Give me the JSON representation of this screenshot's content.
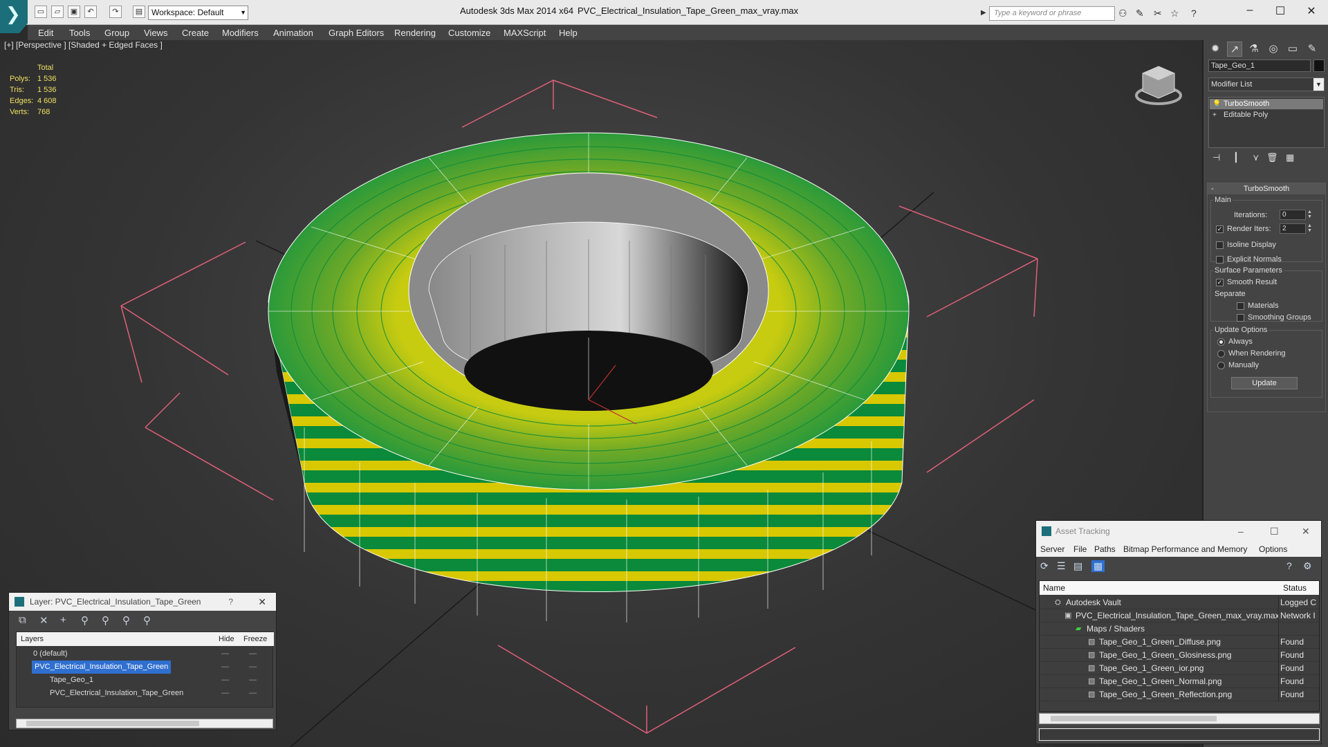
{
  "titlebar": {
    "workspace": "Workspace: Default",
    "app_title": "Autodesk 3ds Max  2014 x64",
    "file_title": "PVC_Electrical_Insulation_Tape_Green_max_vray.max",
    "search_placeholder": "Type a keyword or phrase"
  },
  "menu": [
    "Edit",
    "Tools",
    "Group",
    "Views",
    "Create",
    "Modifiers",
    "Animation",
    "Graph Editors",
    "Rendering",
    "Customize",
    "MAXScript",
    "Help"
  ],
  "viewport": {
    "label": "[+] [Perspective ] [Shaded + Edged Faces ]",
    "stats_header": "Total",
    "stats": [
      {
        "label": "Polys:",
        "value": "1 536"
      },
      {
        "label": "Tris:",
        "value": "1 536"
      },
      {
        "label": "Edges:",
        "value": "4 608"
      },
      {
        "label": "Verts:",
        "value": "768"
      }
    ]
  },
  "command_panel": {
    "object_name": "Tape_Geo_1",
    "modifier_list": "Modifier List",
    "stack": [
      {
        "label": "TurboSmooth",
        "selected": true
      },
      {
        "label": "Editable Poly",
        "selected": false
      }
    ],
    "rollout_title": "TurboSmooth",
    "main_group": "Main",
    "iterations_label": "Iterations:",
    "iterations_value": "0",
    "render_iters_label": "Render Iters:",
    "render_iters_value": "2",
    "isoline_label": "Isoline Display",
    "explicit_normals_label": "Explicit Normals",
    "surface_group": "Surface Parameters",
    "smooth_result_label": "Smooth Result",
    "separate_label": "Separate",
    "materials_label": "Materials",
    "smoothing_groups_label": "Smoothing Groups",
    "update_group": "Update Options",
    "always_label": "Always",
    "when_rendering_label": "When Rendering",
    "manually_label": "Manually",
    "update_button": "Update"
  },
  "layer_dialog": {
    "title": "Layer: PVC_Electrical_Insulation_Tape_Green",
    "help": "?",
    "col_layers": "Layers",
    "col_hide": "Hide",
    "col_freeze": "Freeze",
    "rows": [
      {
        "name": "0 (default)"
      },
      {
        "name": "PVC_Electrical_Insulation_Tape_Green"
      },
      {
        "name": "Tape_Geo_1"
      },
      {
        "name": "PVC_Electrical_Insulation_Tape_Green"
      }
    ]
  },
  "asset_dialog": {
    "title": "Asset Tracking",
    "menu": [
      "Server",
      "File",
      "Paths",
      "Bitmap Performance and Memory",
      "Options"
    ],
    "col_name": "Name",
    "col_status": "Status",
    "rows": [
      {
        "name": "Autodesk Vault",
        "status": "Logged C"
      },
      {
        "name": "PVC_Electrical_Insulation_Tape_Green_max_vray.max",
        "status": "Network I"
      },
      {
        "name": "Maps / Shaders",
        "status": ""
      },
      {
        "name": "Tape_Geo_1_Green_Diffuse.png",
        "status": "Found"
      },
      {
        "name": "Tape_Geo_1_Green_Glosiness.png",
        "status": "Found"
      },
      {
        "name": "Tape_Geo_1_Green_ior.png",
        "status": "Found"
      },
      {
        "name": "Tape_Geo_1_Green_Normal.png",
        "status": "Found"
      },
      {
        "name": "Tape_Geo_1_Green_Reflection.png",
        "status": "Found"
      }
    ]
  },
  "colors": {
    "tape_green": "#0a8a3a",
    "tape_yellow": "#d8c800",
    "selection_blue": "#2f6fd0",
    "bbox_pink": "#e0607a"
  }
}
